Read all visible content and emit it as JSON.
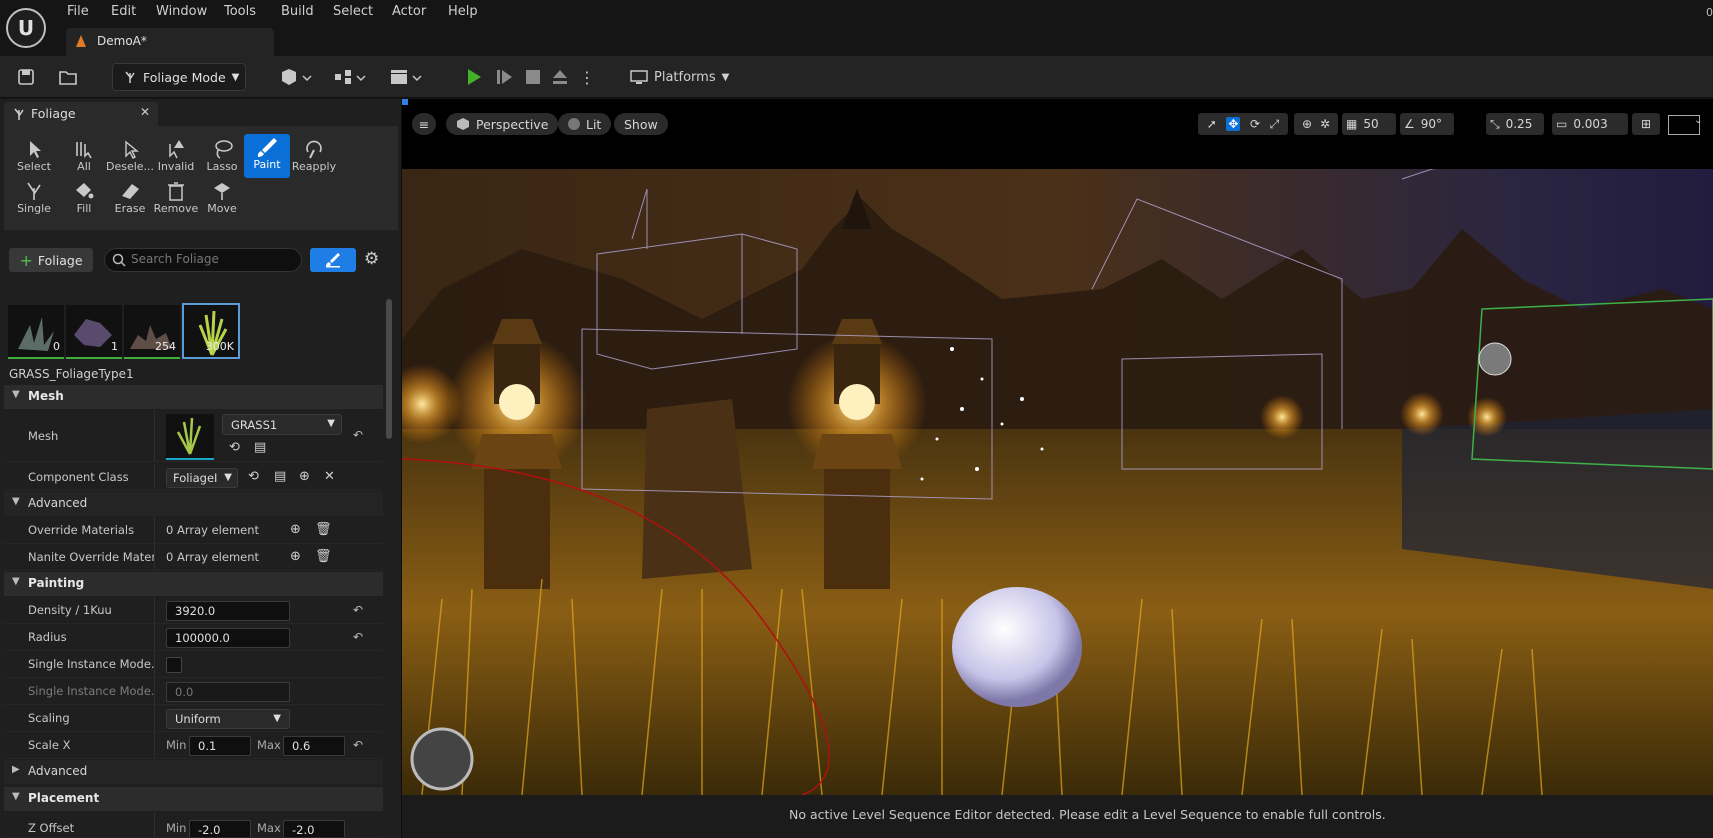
{
  "app": {
    "level_tab": "DemoA*",
    "corner_text": "0"
  },
  "menu": [
    "File",
    "Edit",
    "Window",
    "Tools",
    "Build",
    "Select",
    "Actor",
    "Help"
  ],
  "toolbar": {
    "mode": "Foliage Mode",
    "platforms": "Platforms"
  },
  "panel": {
    "title": "Foliage",
    "tools_row1": [
      "Select",
      "All",
      "Desele...",
      "Invalid",
      "Lasso",
      "Paint",
      "Reapply"
    ],
    "tools_row2": [
      "Single",
      "Fill",
      "Erase",
      "Remove",
      "Move"
    ],
    "active_tool": "Paint",
    "add_button": "Foliage",
    "search_placeholder": "Search Foliage",
    "thumbnails": [
      {
        "count": "0"
      },
      {
        "count": "1"
      },
      {
        "count": "254"
      },
      {
        "count": "300K"
      }
    ],
    "selected_type": "GRASS_FoliageType1",
    "sections": {
      "mesh": "Mesh",
      "advanced": "Advanced",
      "painting": "Painting",
      "advanced2": "Advanced",
      "placement": "Placement"
    },
    "rows": {
      "mesh_label": "Mesh",
      "mesh_value": "GRASS1",
      "component_class_label": "Component Class",
      "component_class_value": "FoliageI",
      "override_materials_label": "Override Materials",
      "override_materials_value": "0 Array element",
      "nanite_override_label": "Nanite Override Materi...",
      "nanite_override_value": "0 Array element",
      "density_label": "Density / 1Kuu",
      "density_value": "3920.0",
      "radius_label": "Radius",
      "radius_value": "100000.0",
      "single_instance_label": "Single Instance Mode...",
      "single_instance2_label": "Single Instance Mode...",
      "single_instance2_value": "0.0",
      "scaling_label": "Scaling",
      "scaling_value": "Uniform",
      "scale_x_label": "Scale X",
      "min_label": "Min",
      "max_label": "Max",
      "scale_x_min": "0.1",
      "scale_x_max": "0.6",
      "z_offset_label": "Z Offset",
      "z_offset_min": "-2.0",
      "z_offset_max": "-2.0"
    }
  },
  "viewport": {
    "perspective": "Perspective",
    "lit": "Lit",
    "show": "Show",
    "grid_snap": "50",
    "rot_snap": "90°",
    "scale_snap": "0.25",
    "camera_speed": "0.003"
  },
  "status": {
    "message": "No active Level Sequence Editor detected. Please edit a Level Sequence to enable full controls."
  },
  "colors": {
    "accent": "#0a6fd6",
    "play": "#43b02a"
  }
}
